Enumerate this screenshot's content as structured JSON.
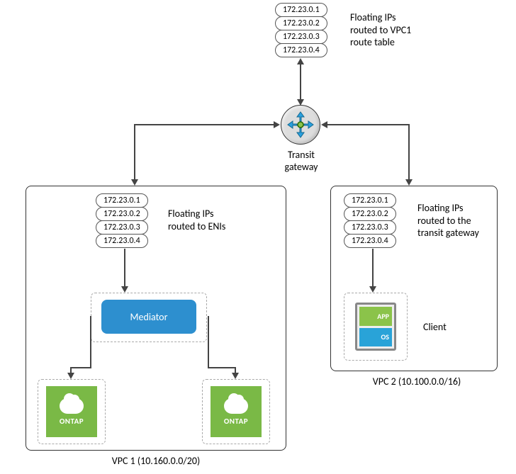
{
  "top": {
    "ips": [
      "172.23.0.1",
      "172.23.0.2",
      "172.23.0.3",
      "172.23.0.4"
    ],
    "label_l1": "Floating IPs",
    "label_l2": "routed to VPC1",
    "label_l3": "route table"
  },
  "transit": {
    "label_l1": "Transit",
    "label_l2": "gateway"
  },
  "vpc1": {
    "caption": "VPC 1 (10.160.0.0/20)",
    "ips": [
      "172.23.0.1",
      "172.23.0.2",
      "172.23.0.3",
      "172.23.0.4"
    ],
    "label_l1": "Floating IPs",
    "label_l2": "routed to ENIs",
    "mediator": "Mediator",
    "ontap": "ONTAP"
  },
  "vpc2": {
    "caption": "VPC 2 (10.100.0.0/16)",
    "ips": [
      "172.23.0.1",
      "172.23.0.2",
      "172.23.0.3",
      "172.23.0.4"
    ],
    "label_l1": "Floating IPs",
    "label_l2": "routed to the",
    "label_l3": "transit gateway",
    "client_label": "Client",
    "app": "APP",
    "os": "OS"
  }
}
